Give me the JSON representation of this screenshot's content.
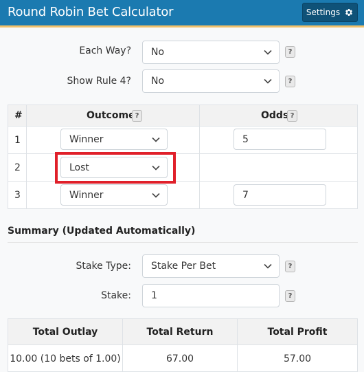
{
  "header": {
    "title": "Round Robin Bet Calculator",
    "settings_label": "Settings",
    "settings_icon": "gear-icon"
  },
  "options": {
    "each_way": {
      "label": "Each Way?",
      "value": "No",
      "help": "?"
    },
    "show_rule4": {
      "label": "Show Rule 4?",
      "value": "No",
      "help": "?"
    }
  },
  "selections_table": {
    "headers": {
      "index": "#",
      "outcome": "Outcome",
      "odds": "Odds",
      "help": "?"
    },
    "rows": [
      {
        "index": "1",
        "outcome": "Winner",
        "odds": "5"
      },
      {
        "index": "2",
        "outcome": "Lost",
        "odds": ""
      },
      {
        "index": "3",
        "outcome": "Winner",
        "odds": "7"
      }
    ]
  },
  "summary": {
    "title": "Summary (Updated Automatically)",
    "stake_type": {
      "label": "Stake Type:",
      "value": "Stake Per Bet",
      "help": "?"
    },
    "stake": {
      "label": "Stake:",
      "value": "1",
      "help": "?"
    },
    "results_table": {
      "headers": [
        "Total Outlay",
        "Total Return",
        "Total Profit"
      ],
      "values": [
        "10.00 (10 bets of 1.00)",
        "67.00",
        "57.00"
      ]
    }
  },
  "colors": {
    "header_bg": "#1b7ab0",
    "header_accent": "#f0c06a",
    "settings_bg": "#0f5278",
    "highlight": "#e0202a"
  }
}
